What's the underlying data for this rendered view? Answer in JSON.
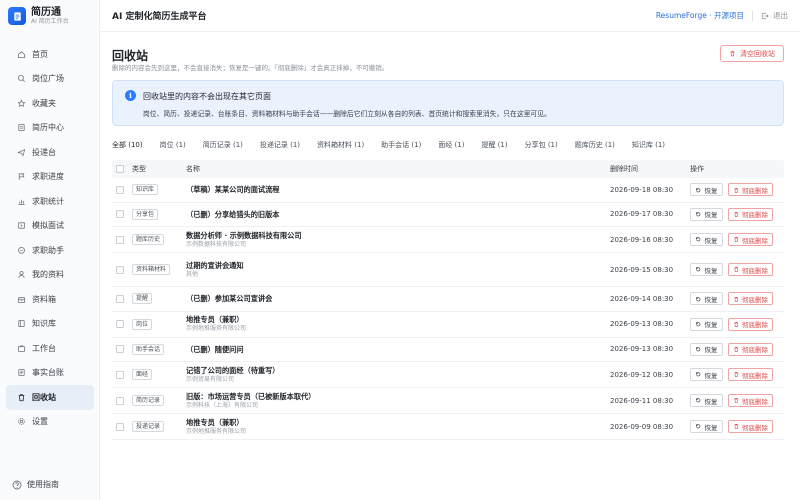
{
  "brand": {
    "name": "简历通",
    "subtitle": "AI 简历工作台"
  },
  "header": {
    "title": "AI 定制化简历生成平台",
    "project_link": "ResumeForge · 开源项目",
    "logout": "退出"
  },
  "sidebar": {
    "items": [
      {
        "label": "首页",
        "icon": "home-icon"
      },
      {
        "label": "岗位广场",
        "icon": "search-icon"
      },
      {
        "label": "收藏夹",
        "icon": "star-icon"
      },
      {
        "label": "简历中心",
        "icon": "document-icon"
      },
      {
        "label": "投递台",
        "icon": "send-icon"
      },
      {
        "label": "求职进度",
        "icon": "flag-icon"
      },
      {
        "label": "求职统计",
        "icon": "chart-icon"
      },
      {
        "label": "模拟面试",
        "icon": "play-icon"
      },
      {
        "label": "求职助手",
        "icon": "chat-icon"
      },
      {
        "label": "我的资料",
        "icon": "user-icon"
      },
      {
        "label": "资料箱",
        "icon": "box-icon"
      },
      {
        "label": "知识库",
        "icon": "book-icon"
      },
      {
        "label": "工作台",
        "icon": "briefcase-icon"
      },
      {
        "label": "事实台账",
        "icon": "ledger-icon"
      },
      {
        "label": "回收站",
        "icon": "trash-icon"
      },
      {
        "label": "设置",
        "icon": "gear-icon"
      }
    ],
    "active_index": 14,
    "footer": "使用指南"
  },
  "page": {
    "title": "回收站",
    "subtitle": "删除的内容会先到这里，不会直接消失；恢复是一键的。「彻底删除」才会真正抹掉，不可撤销。",
    "clear_button": "清空回收站"
  },
  "info": {
    "title": "回收站里的内容不会出现在其它页面",
    "text": "岗位、简历、投递记录、台账条目、资料箱材料与助手会话——删除后它们立刻从各自的列表、首页统计和搜索里消失，只在这里可见。"
  },
  "tabs": [
    "全部 (10)",
    "岗位 (1)",
    "简历记录 (1)",
    "投递记录 (1)",
    "资料箱材料 (1)",
    "助手会话 (1)",
    "面经 (1)",
    "提醒 (1)",
    "分享包 (1)",
    "题库历史 (1)",
    "知识库 (1)"
  ],
  "table": {
    "headers": {
      "type": "类型",
      "name": "名称",
      "time": "删除时间",
      "ops": "操作"
    },
    "restore_label": "恢复",
    "delete_label": "彻底删除",
    "rows": [
      {
        "type": "知识库",
        "name": "（草稿）某某公司的面试流程",
        "sub": "",
        "time": "2026-09-18 08:30"
      },
      {
        "type": "分享包",
        "name": "（已删）分享给猎头的旧版本",
        "sub": "",
        "time": "2026-09-17 08:30"
      },
      {
        "type": "题库历史",
        "name": "数据分析师 · 示例数据科技有限公司",
        "sub": "示例数据科技有限公司",
        "time": "2026-09-16 08:30"
      },
      {
        "type": "资料箱材料",
        "name": "过期的宣讲会通知",
        "sub": "其他",
        "time": "2026-09-15 08:30"
      },
      {
        "type": "提醒",
        "name": "（已删）参加某公司宣讲会",
        "sub": "",
        "time": "2026-09-14 08:30"
      },
      {
        "type": "岗位",
        "name": "地推专员（兼职）",
        "sub": "示例地推服务有限公司",
        "time": "2026-09-13 08:30"
      },
      {
        "type": "助手会话",
        "name": "（已删）随便问问",
        "sub": "",
        "time": "2026-09-13 08:30"
      },
      {
        "type": "面经",
        "name": "记错了公司的面经（待重写）",
        "sub": "示例贸易有限公司",
        "time": "2026-09-12 08:30"
      },
      {
        "type": "简历记录",
        "name": "旧版：市场运营专员（已被新版本取代）",
        "sub": "示例科技（上海）有限公司",
        "time": "2026-09-11 08:30"
      },
      {
        "type": "投递记录",
        "name": "地推专员（兼职）",
        "sub": "示例地推服务有限公司",
        "time": "2026-09-09 08:30"
      }
    ]
  }
}
